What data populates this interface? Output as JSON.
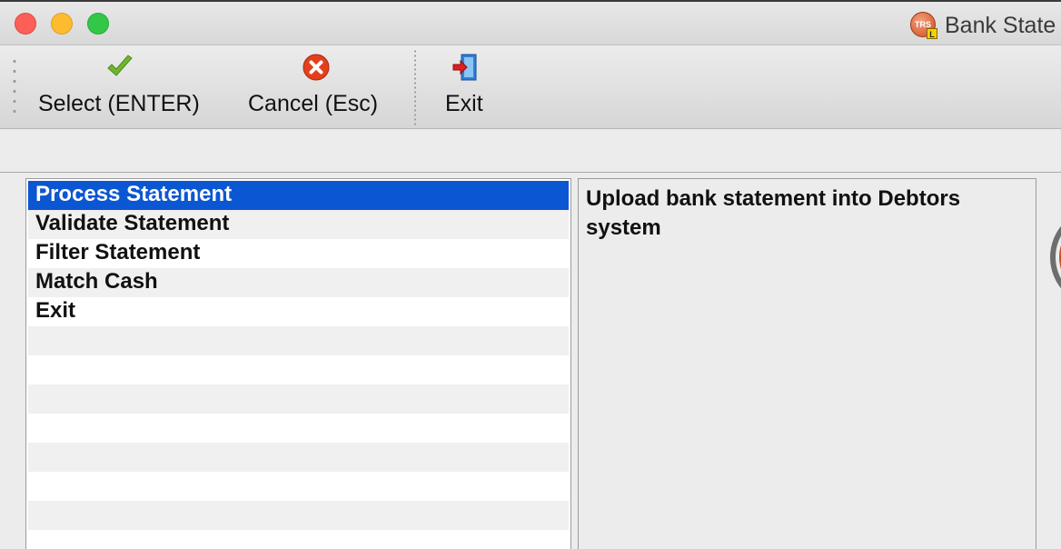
{
  "window": {
    "title": "Bank State",
    "app_icon_text": "TRS",
    "app_icon_badge": "L"
  },
  "toolbar": {
    "select_label": "Select (ENTER)",
    "cancel_label": "Cancel (Esc)",
    "exit_label": "Exit",
    "icons": {
      "select": "checkmark-icon",
      "cancel": "cancel-icon",
      "exit": "exit-door-icon"
    }
  },
  "menu": {
    "items": [
      {
        "label": "Process Statement",
        "selected": true
      },
      {
        "label": "Validate Statement",
        "selected": false
      },
      {
        "label": "Filter Statement",
        "selected": false
      },
      {
        "label": "Match Cash",
        "selected": false
      },
      {
        "label": "Exit",
        "selected": false
      }
    ],
    "empty_rows": 8
  },
  "description": {
    "text": "Upload bank statement into Debtors system"
  },
  "colors": {
    "selection": "#0b56d2",
    "close": "#fc5f57",
    "minimize": "#fdbc2e",
    "maximize": "#33c748"
  }
}
